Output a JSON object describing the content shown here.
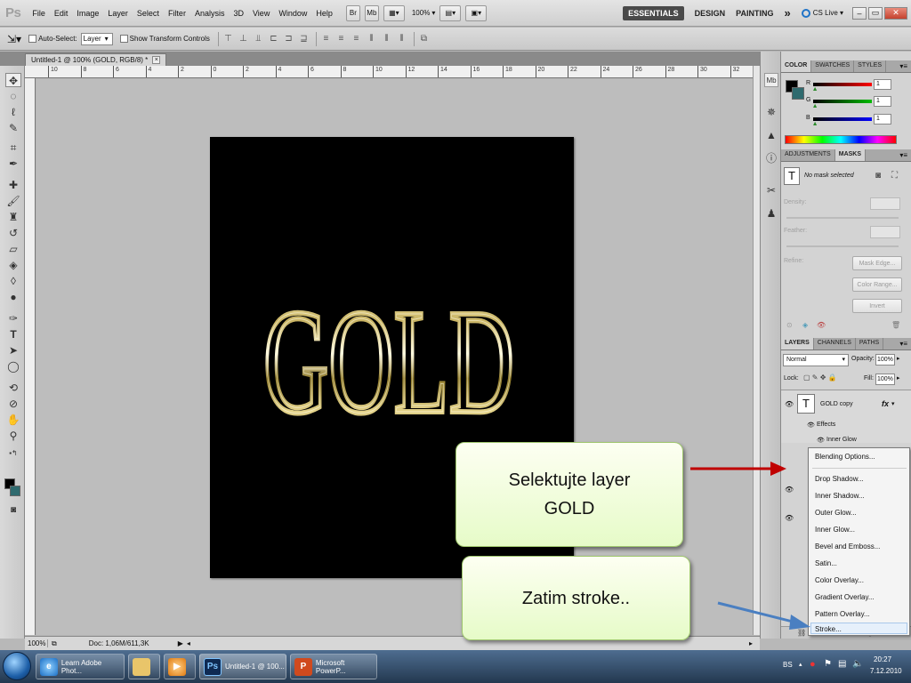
{
  "app": {
    "logo": "Ps"
  },
  "menu": [
    "File",
    "Edit",
    "Image",
    "Layer",
    "Select",
    "Filter",
    "Analysis",
    "3D",
    "View",
    "Window",
    "Help"
  ],
  "menubar_controls": {
    "br": "Br",
    "mb": "Mb",
    "zoom": "100%"
  },
  "workspaces": {
    "active": "ESSENTIALS",
    "design": "DESIGN",
    "painting": "PAINTING",
    "more": "»",
    "cslive": "CS Live ▾"
  },
  "window_buttons": {
    "minimize": "–",
    "restore": "▭",
    "close": "✕"
  },
  "options": {
    "auto_select_label": "Auto-Select:",
    "auto_select_value": "Layer",
    "show_transform": "Show Transform Controls"
  },
  "document": {
    "tab_title": "Untitled-1 @ 100% (GOLD, RGB/8) *",
    "close": "×"
  },
  "ruler": {
    "labels": [
      "10",
      "8",
      "6",
      "4",
      "2",
      "0",
      "2",
      "4",
      "6",
      "8",
      "10",
      "12",
      "14",
      "16",
      "18",
      "20",
      "22",
      "24",
      "26",
      "28",
      "30",
      "32"
    ]
  },
  "canvas_text": "GOLD",
  "status": {
    "zoom": "100%",
    "doc": "Doc: 1,06M/611,3K"
  },
  "color_panel": {
    "tabs": [
      "COLOR",
      "SWATCHES",
      "STYLES"
    ],
    "r_label": "R",
    "g_label": "G",
    "b_label": "B",
    "r_value": "1",
    "g_value": "1",
    "b_value": "1",
    "r_level": 0.01,
    "g_level": 0.01,
    "b_level": 0.01
  },
  "masks_panel": {
    "tabs": [
      "ADJUSTMENTS",
      "MASKS"
    ],
    "no_mask": "No mask selected",
    "density": "Density:",
    "feather": "Feather:",
    "refine": "Refine:",
    "mask_edge": "Mask Edge...",
    "color_range": "Color Range...",
    "invert": "Invert"
  },
  "layers_panel": {
    "tabs": [
      "LAYERS",
      "CHANNELS",
      "PATHS"
    ],
    "blend_mode": "Normal",
    "opacity_label": "Opacity:",
    "opacity_value": "100%",
    "lock_label": "Lock:",
    "fill_label": "Fill:",
    "fill_value": "100%",
    "layer_name": "GOLD copy",
    "fx": "fx",
    "effects_label": "Effects",
    "inner_glow_label": "Inner Glow"
  },
  "context_menu": [
    "Blending Options...",
    "Drop Shadow...",
    "Inner Shadow...",
    "Outer Glow...",
    "Inner Glow...",
    "Bevel and Emboss...",
    "Satin...",
    "Color Overlay...",
    "Gradient Overlay...",
    "Pattern Overlay...",
    "Stroke..."
  ],
  "callouts": {
    "first": "Selektujte layer GOLD",
    "second": "Zatim stroke.."
  },
  "taskbar": {
    "items": [
      "Learn Adobe Phot...",
      "Untitled-1 @ 100...",
      "Microsoft PowerP..."
    ],
    "lang": "BS",
    "time": "20:27",
    "date": "7.12.2010"
  },
  "colors": {
    "red_arrow": "#c00000",
    "blue_arrow": "#4a7fc1",
    "callout_border": "#9fc76e"
  }
}
